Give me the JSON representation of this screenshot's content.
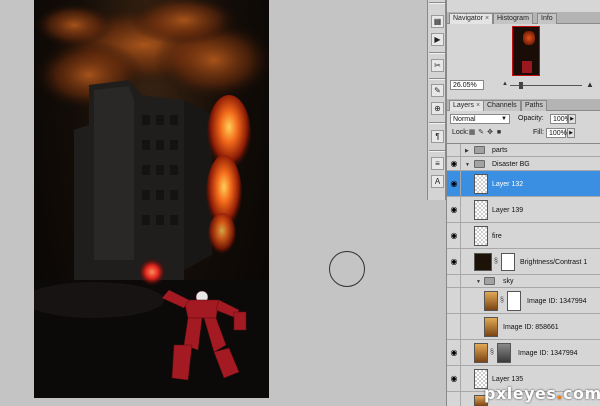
{
  "navigator": {
    "tabs": [
      {
        "label": "Navigator",
        "close": "×"
      },
      {
        "label": "Histogram"
      },
      {
        "label": "Info"
      }
    ],
    "zoom": "26.05%"
  },
  "layers_panel": {
    "tabs": [
      {
        "label": "Layers",
        "close": "×"
      },
      {
        "label": "Channels"
      },
      {
        "label": "Paths"
      }
    ],
    "blend_mode": "Normal",
    "opacity_label": "Opacity:",
    "opacity": "100%",
    "lock_label": "Lock:",
    "fill_label": "Fill:",
    "fill": "100%",
    "layers": [
      {
        "name": "parts",
        "kind": "group"
      },
      {
        "name": "Disaster BG",
        "kind": "group-open"
      },
      {
        "name": "Layer 132",
        "kind": "layer",
        "selected": true
      },
      {
        "name": "Layer 139",
        "kind": "layer"
      },
      {
        "name": "fire",
        "kind": "layer"
      },
      {
        "name": "Brightness/Contrast 1",
        "kind": "adjustment"
      },
      {
        "name": "sky",
        "kind": "group-open"
      },
      {
        "name": "Image ID: 1347994",
        "kind": "masked"
      },
      {
        "name": "Image ID: 858661",
        "kind": "layer"
      },
      {
        "name": "Image ID: 1347994",
        "kind": "masked"
      },
      {
        "name": "Layer 135",
        "kind": "layer"
      }
    ]
  },
  "watermark": {
    "text": "pxleyes",
    "dot": ".",
    "tld": "com"
  },
  "colors": {
    "selection": "#3b8fe3",
    "panel_bg": "#d6d6d6",
    "canvas_bg": "#c4c4c4",
    "brand_orange": "#f07b14"
  }
}
